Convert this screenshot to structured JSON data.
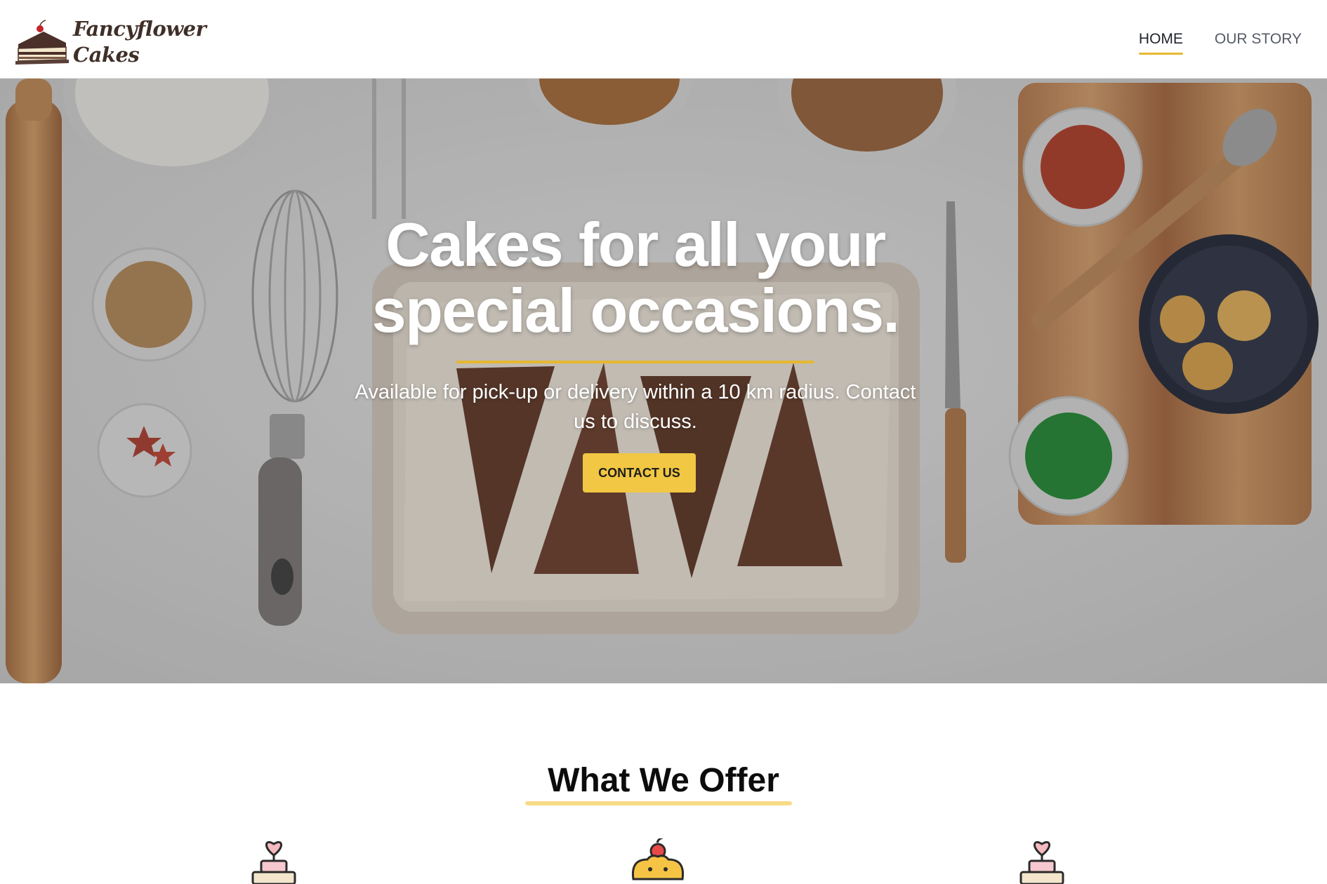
{
  "brand": {
    "name_line1": "Fancyflower",
    "name_line2": "Cakes",
    "logo_icon": "cake-slice-icon"
  },
  "nav": {
    "items": [
      {
        "label": "HOME",
        "active": true
      },
      {
        "label": "OUR STORY",
        "active": false
      }
    ]
  },
  "hero": {
    "title_line1": "Cakes for all your",
    "title_line2": "special occasions.",
    "subtitle_line1": "Available for pick-up or delivery within a 10 km radius. Contact",
    "subtitle_line2": "us to discuss.",
    "cta_label": "CONTACT US",
    "background": "overhead photo of baking ingredients and brownies on a tray"
  },
  "offer": {
    "title": "What We Offer",
    "icons": [
      "layer-cake-heart-icon",
      "cupcake-cherry-icon",
      "layer-cake-heart-icon"
    ]
  },
  "colors": {
    "accent": "#e6b830",
    "button": "#f1c743",
    "offer_underline": "#f7dc86",
    "nav_active": "#1f232b",
    "nav_inactive": "#555a66"
  }
}
